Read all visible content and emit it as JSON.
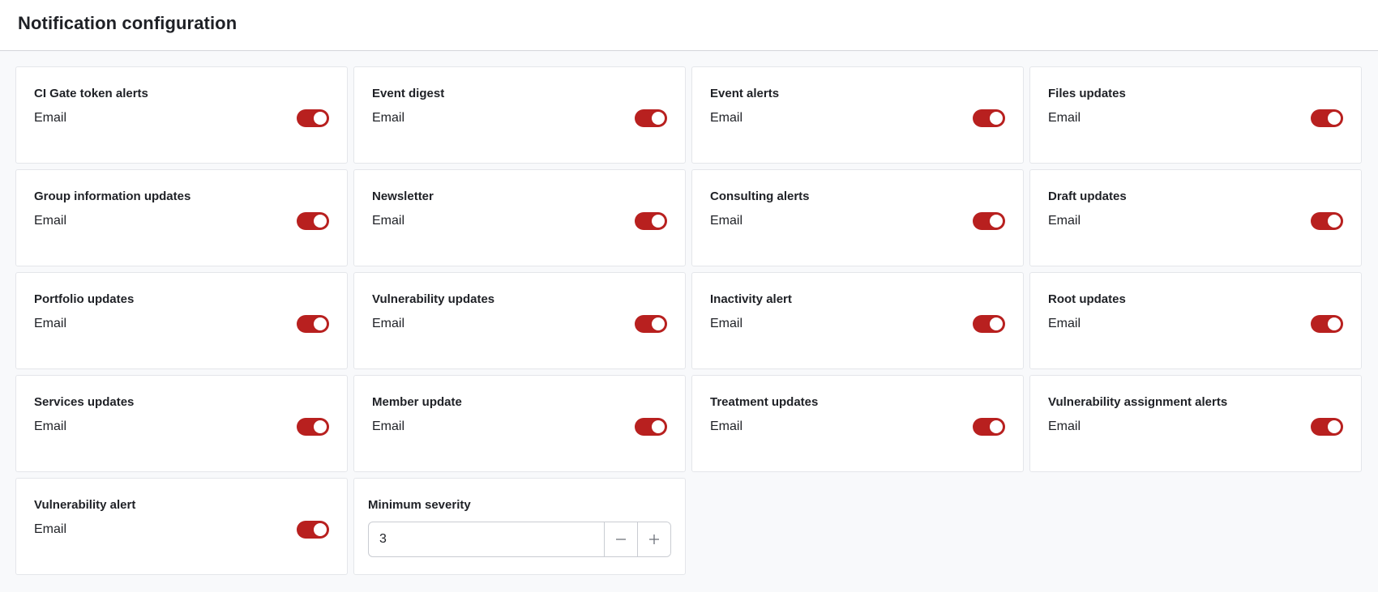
{
  "header": {
    "title": "Notification configuration"
  },
  "notifications": [
    {
      "title": "CI Gate token alerts",
      "channel": "Email",
      "enabled": true
    },
    {
      "title": "Event digest",
      "channel": "Email",
      "enabled": true
    },
    {
      "title": "Event alerts",
      "channel": "Email",
      "enabled": true
    },
    {
      "title": "Files updates",
      "channel": "Email",
      "enabled": true
    },
    {
      "title": "Group information updates",
      "channel": "Email",
      "enabled": true
    },
    {
      "title": "Newsletter",
      "channel": "Email",
      "enabled": true
    },
    {
      "title": "Consulting alerts",
      "channel": "Email",
      "enabled": true
    },
    {
      "title": "Draft updates",
      "channel": "Email",
      "enabled": true
    },
    {
      "title": "Portfolio updates",
      "channel": "Email",
      "enabled": true
    },
    {
      "title": "Vulnerability updates",
      "channel": "Email",
      "enabled": true
    },
    {
      "title": "Inactivity alert",
      "channel": "Email",
      "enabled": true
    },
    {
      "title": "Root updates",
      "channel": "Email",
      "enabled": true
    },
    {
      "title": "Services updates",
      "channel": "Email",
      "enabled": true
    },
    {
      "title": "Member update",
      "channel": "Email",
      "enabled": true
    },
    {
      "title": "Treatment updates",
      "channel": "Email",
      "enabled": true
    },
    {
      "title": "Vulnerability assignment alerts",
      "channel": "Email",
      "enabled": true
    },
    {
      "title": "Vulnerability alert",
      "channel": "Email",
      "enabled": true
    }
  ],
  "severity": {
    "title": "Minimum severity",
    "value": "3",
    "decrement_icon": "minus-icon",
    "increment_icon": "plus-icon"
  },
  "colors": {
    "toggle_on": "#b8201f",
    "background": "#f8f9fb"
  }
}
